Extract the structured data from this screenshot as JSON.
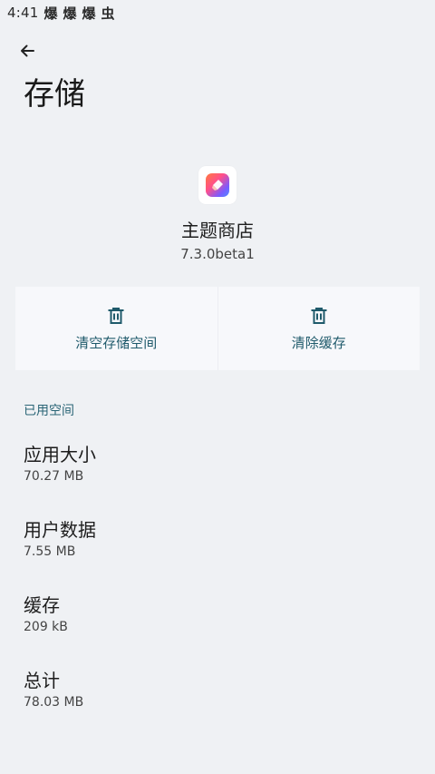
{
  "status_bar": {
    "time": "4:41",
    "notification_icons": [
      "爆",
      "爆",
      "爆",
      "虫"
    ]
  },
  "header": {
    "back_icon": "arrow-left-icon",
    "title": "存储"
  },
  "app": {
    "icon": "theme-store-app-icon",
    "name": "主题商店",
    "version": "7.3.0beta1"
  },
  "actions": {
    "clear_storage": {
      "label": "清空存储空间",
      "icon": "trash-icon"
    },
    "clear_cache": {
      "label": "清除缓存",
      "icon": "trash-icon"
    }
  },
  "colors": {
    "accent": "#1f5a6b",
    "section_header": "#2a6576",
    "background": "#eff1f4"
  },
  "used_space": {
    "header": "已用空间",
    "items": [
      {
        "label": "应用大小",
        "value": "70.27 MB"
      },
      {
        "label": "用户数据",
        "value": "7.55 MB"
      },
      {
        "label": "缓存",
        "value": "209 kB"
      },
      {
        "label": "总计",
        "value": "78.03 MB"
      }
    ]
  }
}
